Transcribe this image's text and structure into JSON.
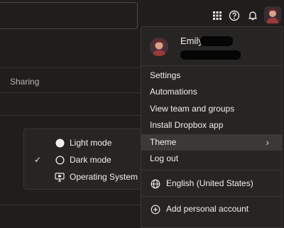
{
  "background": {
    "sharing_label": "Sharing"
  },
  "topbar": {
    "icons": [
      "apps-grid-icon",
      "help-icon",
      "bell-icon",
      "avatar"
    ]
  },
  "account_menu": {
    "profile": {
      "name": "Emily"
    },
    "items": [
      {
        "label": "Settings"
      },
      {
        "label": "Automations"
      },
      {
        "label": "View team and groups"
      },
      {
        "label": "Install Dropbox app"
      },
      {
        "label": "Theme"
      },
      {
        "label": "Log out"
      }
    ],
    "language": "English (United States)",
    "add_account": "Add personal account"
  },
  "theme_menu": {
    "items": [
      {
        "label": "Light mode",
        "icon": "filled-circle-icon",
        "checked": false
      },
      {
        "label": "Dark mode",
        "icon": "outline-circle-icon",
        "checked": true
      },
      {
        "label": "Operating System",
        "icon": "monitor-icon",
        "checked": false
      }
    ]
  },
  "colors": {
    "background": "#1f1e1d",
    "menu": "#262523",
    "hover": "#3b3936",
    "text": "#f2f0ed"
  }
}
